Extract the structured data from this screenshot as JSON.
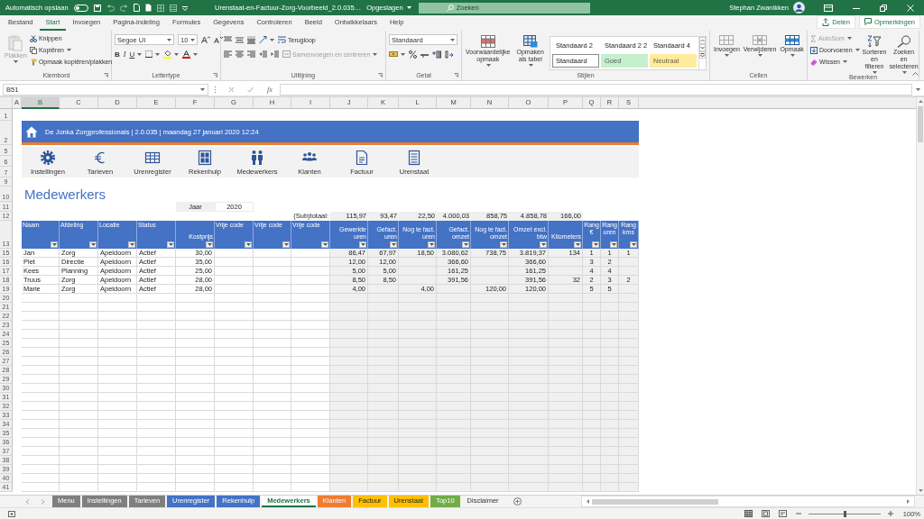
{
  "title_bar": {
    "autosave_label": "Automatisch opslaan",
    "autosave_on": false,
    "file_name": "Urenstaat-en-Factuur-Zorg-Voorbeeld_2.0.035…",
    "save_status": "Opgeslagen",
    "search": {
      "placeholder": "Zoeken"
    },
    "user_name": "Stephan Zwanikken"
  },
  "ribbon_tabs": [
    {
      "label": "Bestand",
      "selected": false
    },
    {
      "label": "Start",
      "selected": true
    },
    {
      "label": "Invoegen",
      "selected": false
    },
    {
      "label": "Pagina-indeling",
      "selected": false
    },
    {
      "label": "Formules",
      "selected": false
    },
    {
      "label": "Gegevens",
      "selected": false
    },
    {
      "label": "Controleren",
      "selected": false
    },
    {
      "label": "Beeld",
      "selected": false
    },
    {
      "label": "Ontwikkelaars",
      "selected": false
    },
    {
      "label": "Help",
      "selected": false
    }
  ],
  "ribbon_actions": [
    "Delen",
    "Opmerkingen"
  ],
  "ribbon": {
    "clipboard": {
      "label": "Klembord",
      "paste": {
        "label": "Plakken",
        "disabled": true
      },
      "cut": "Knippen",
      "copy": "Kopiëren",
      "format_painter": "Opmaak kopiëren/plakken"
    },
    "font": {
      "label": "Lettertype",
      "font_name": "Segoe UI",
      "font_size": "10",
      "format_buttons": [
        "B",
        "I",
        "U"
      ]
    },
    "alignment": {
      "label": "Uitlijning",
      "wrap": "Terugloop",
      "merge": {
        "label": "Samenvoegen en centreren",
        "disabled": true
      }
    },
    "number": {
      "label": "Getal",
      "format": "Standaard"
    },
    "styles": {
      "label": "Stijlen",
      "conditional": "Voorwaardelijke opmaak",
      "format_table": "Opmaken als tabel",
      "gallery": [
        {
          "label": "Standaard 2",
          "color": "#ffffff",
          "selected": false
        },
        {
          "label": "Standaard 2 2",
          "color": "#ffffff",
          "selected": false
        },
        {
          "label": "Standaard 4",
          "color": "#ffffff",
          "selected": false
        },
        {
          "label": "Standaard",
          "color": "#ffffff",
          "selected": true
        },
        {
          "label": "Goed",
          "color": "#c6efce",
          "selected": false
        },
        {
          "label": "Neutraal",
          "color": "#ffeb9c",
          "selected": false
        }
      ]
    },
    "cells": {
      "label": "Cellen",
      "buttons": [
        "Invoegen",
        "Verwijderen",
        "Opmaak"
      ]
    },
    "editing": {
      "label": "Bewerken",
      "autosum": {
        "label": "AutoSom",
        "disabled": true
      },
      "fill": "Doorvoeren",
      "clear": "Wissen",
      "sort": "Sorteren en filteren",
      "find": "Zoeken en selecteren"
    }
  },
  "formula_bar": {
    "name_box": "B51",
    "function_label": "fx"
  },
  "sheet": {
    "columns": [
      {
        "label": "A",
        "selected": false
      },
      {
        "label": "B",
        "selected": true
      },
      {
        "label": "C",
        "selected": false
      },
      {
        "label": "D",
        "selected": false
      },
      {
        "label": "E",
        "selected": false
      },
      {
        "label": "F",
        "selected": false
      },
      {
        "label": "G",
        "selected": false
      },
      {
        "label": "H",
        "selected": false
      },
      {
        "label": "I",
        "selected": false
      },
      {
        "label": "J",
        "selected": false
      },
      {
        "label": "K",
        "selected": false
      },
      {
        "label": "L",
        "selected": false
      },
      {
        "label": "M",
        "selected": false
      },
      {
        "label": "N",
        "selected": false
      },
      {
        "label": "O",
        "selected": false
      },
      {
        "label": "P",
        "selected": false
      },
      {
        "label": "Q",
        "selected": false
      },
      {
        "label": "R",
        "selected": false
      },
      {
        "label": "S",
        "selected": false
      }
    ],
    "row_numbers": [
      "1",
      "2",
      "5",
      "6",
      "7",
      "9",
      "10",
      "11",
      "12",
      "13",
      "15",
      "16",
      "17",
      "18",
      "19",
      "20",
      "21",
      "22",
      "23",
      "24",
      "25",
      "26",
      "27",
      "28",
      "29",
      "30",
      "31",
      "32",
      "33",
      "34",
      "35",
      "36",
      "37",
      "38",
      "39",
      "40",
      "41"
    ],
    "banner": "De Jonka Zorgprofessionals | 2.0.035 | maandag 27 januari 2020 12:24",
    "nav": [
      "Instellingen",
      "Tarieven",
      "Urenregister",
      "Rekenhulp",
      "Medewerkers",
      "Klanten",
      "Factuur",
      "Urenstaat"
    ],
    "title": "Medewerkers",
    "year": {
      "label": "Jaar",
      "value": "2020"
    },
    "subtotal": {
      "label": "(Sub)totaal:",
      "values": [
        "115,97",
        "93,47",
        "22,50",
        "4.000,03",
        "858,75",
        "4.858,78",
        "166,00"
      ]
    },
    "table": {
      "headers": [
        "Naam",
        "Afdeling",
        "Locatie",
        "Status",
        "Kostprijs",
        "Vrije code",
        "Vrije code",
        "Vrije code",
        "Gewerkte uren",
        "Gefact. uren",
        "Nog te fact. uren",
        "Gefact. omzet",
        "Nog te fact. omzet",
        "Omzet excl. btw",
        "Kilometers",
        "Rang €",
        "Rang uren",
        "Rang kms"
      ],
      "rows": [
        [
          "Jan",
          "Zorg",
          "Apeldoorn",
          "Actief",
          "30,00",
          null,
          null,
          null,
          "86,47",
          "67,97",
          "18,50",
          "3.080,62",
          "738,75",
          "3.819,37",
          "134",
          "1",
          "1",
          "1"
        ],
        [
          "Piet",
          "Directie",
          "Apeldoorn",
          "Actief",
          "35,00",
          null,
          null,
          null,
          "12,00",
          "12,00",
          null,
          "366,60",
          null,
          "366,60",
          null,
          "3",
          "2",
          null
        ],
        [
          "Kees",
          "Planning",
          "Apeldoorn",
          "Actief",
          "25,00",
          null,
          null,
          null,
          "5,00",
          "5,00",
          null,
          "161,25",
          null,
          "161,25",
          null,
          "4",
          "4",
          null
        ],
        [
          "Truus",
          "Zorg",
          "Apeldoorn",
          "Actief",
          "28,00",
          null,
          null,
          null,
          "8,50",
          "8,50",
          null,
          "391,56",
          null,
          "391,56",
          "32",
          "2",
          "3",
          "2"
        ],
        [
          "Marie",
          "Zorg",
          "Apeldoorn",
          "Actief",
          "28,00",
          null,
          null,
          null,
          "4,00",
          null,
          "4,00",
          null,
          "120,00",
          "120,00",
          null,
          "5",
          "5",
          null
        ]
      ]
    }
  },
  "sheet_tabs": [
    {
      "label": "Menu",
      "color": "#7f7f7f",
      "selected": false
    },
    {
      "label": "Instellingen",
      "color": "#7f7f7f",
      "selected": false
    },
    {
      "label": "Tarieven",
      "color": "#7f7f7f",
      "selected": false
    },
    {
      "label": "Urenregister",
      "color": "#4472c4",
      "selected": false
    },
    {
      "label": "Rekenhulp",
      "color": "#4472c4",
      "selected": false
    },
    {
      "label": "Medewerkers",
      "selected": true
    },
    {
      "label": "Klanten",
      "color": "#ed7d31",
      "selected": false
    },
    {
      "label": "Factuur",
      "color": "#ffc000",
      "selected": false
    },
    {
      "label": "Urenstaat",
      "color": "#ffc000",
      "selected": false
    },
    {
      "label": "Top10",
      "color": "#70ad47",
      "selected": false
    },
    {
      "label": "Disclaimer",
      "selected": false
    }
  ],
  "status_bar": {
    "zoom": "100%",
    "zoom_slider": {
      "level": 0.5
    }
  }
}
